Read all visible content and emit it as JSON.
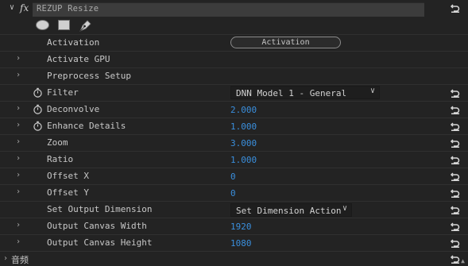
{
  "effect": {
    "fx_label": "fx",
    "name": "REZUP Resize"
  },
  "rows": [
    {
      "label": "Activation",
      "button_label": "Activation"
    },
    {
      "label": "Activate GPU"
    },
    {
      "label": "Preprocess Setup"
    },
    {
      "label": "Filter",
      "dropdown_value": "DNN Model 1 - General"
    },
    {
      "label": "Deconvolve",
      "value": "2.000"
    },
    {
      "label": "Enhance Details",
      "value": "1.000"
    },
    {
      "label": "Zoom",
      "value": "3.000"
    },
    {
      "label": "Ratio",
      "value": "1.000"
    },
    {
      "label": "Offset X",
      "value": "0"
    },
    {
      "label": "Offset Y",
      "value": "0"
    },
    {
      "label": "Set Output Dimension",
      "dropdown_value": "Set Dimension Action"
    },
    {
      "label": "Output Canvas Width",
      "value": "1920"
    },
    {
      "label": "Output Canvas Height",
      "value": "1080"
    }
  ],
  "audio": {
    "label": "音频"
  },
  "colors": {
    "background": "#232323",
    "value_blue": "#3a8fdd",
    "label": "#c8c8c8"
  },
  "icons": {
    "twisty": "chevron-right-icon",
    "stopwatch": "stopwatch-icon",
    "reset": "reset-icon",
    "ellipse_mask": "ellipse-mask-icon",
    "rect_mask": "rectangle-mask-icon",
    "pen_mask": "pen-mask-icon"
  }
}
